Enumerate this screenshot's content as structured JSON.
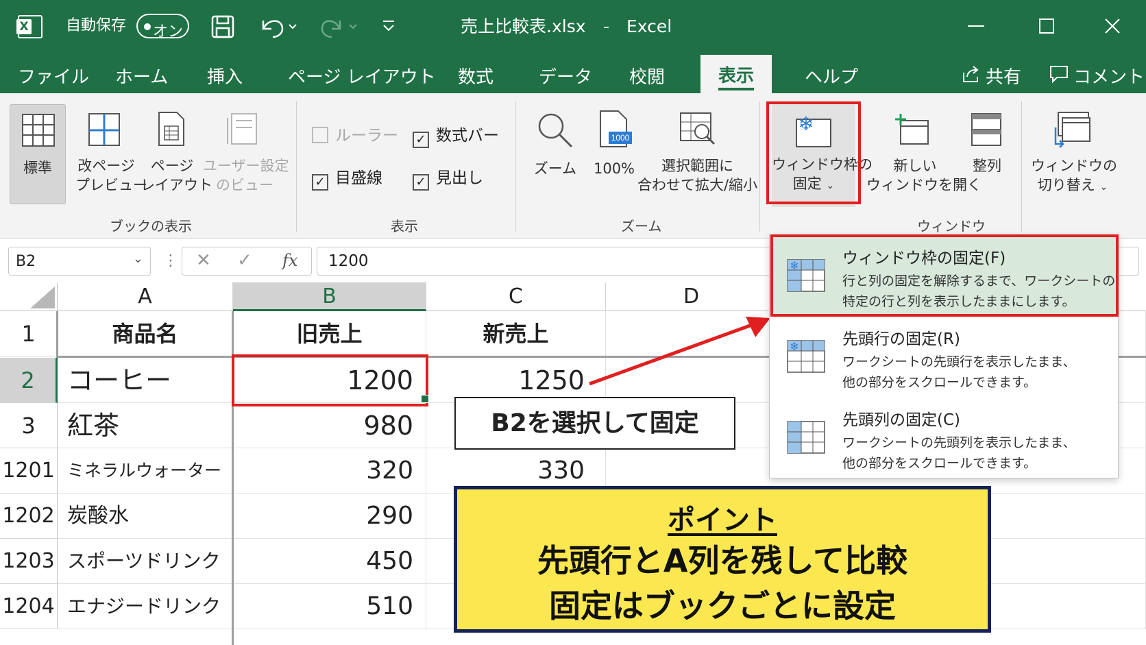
{
  "titlebar": {
    "app_icon": "excel-logo-icon",
    "autosave_label": "自動保存",
    "autosave_state": "オン",
    "filename": "売上比較表.xlsx",
    "separator": "-",
    "app_name": "Excel"
  },
  "menu": {
    "tabs": [
      "ファイル",
      "ホーム",
      "挿入",
      "ページ レイアウト",
      "数式",
      "データ",
      "校閲",
      "表示",
      "ヘルプ"
    ],
    "active_tab": "表示",
    "share": "共有",
    "comment": "コメント"
  },
  "ribbon": {
    "book_view": {
      "label": "ブックの表示",
      "normal": "標準",
      "page_break_1": "改ページ",
      "page_break_2": "プレビュー",
      "page_layout_1": "ページ",
      "page_layout_2": "レイアウト",
      "custom_1": "ユーザー設定",
      "custom_2": "のビュー"
    },
    "show": {
      "label": "表示",
      "ruler": "ルーラー",
      "formula_bar": "数式バー",
      "gridlines": "目盛線",
      "headings": "見出し"
    },
    "zoom": {
      "label": "ズーム",
      "zoom": "ズーム",
      "hundred": "100%",
      "hundred_icon_text": "1000",
      "zoom_sel_1": "選択範囲に",
      "zoom_sel_2": "合わせて拡大/縮小"
    },
    "window": {
      "label": "ウィンドウ",
      "freeze_1": "ウィンドウ枠の",
      "freeze_2": "固定",
      "new_1": "新しい",
      "new_2": "ウィンドウを開く",
      "arrange": "整列",
      "switch_1": "ウィンドウの",
      "switch_2": "切り替え"
    }
  },
  "formula_bar": {
    "name_box": "B2",
    "value": "1200"
  },
  "sheet": {
    "columns": [
      "A",
      "B",
      "C",
      "D"
    ],
    "rows": [
      {
        "num": "1",
        "a": "商品名",
        "b": "旧売上",
        "c": "新売上"
      },
      {
        "num": "2",
        "a": "コーヒー",
        "b": "1200",
        "c": "1250"
      },
      {
        "num": "3",
        "a": "紅茶",
        "b": "980",
        "c": ""
      },
      {
        "num": "1201",
        "a": "ミネラルウォーター",
        "b": "320",
        "c": "330"
      },
      {
        "num": "1202",
        "a": "炭酸水",
        "b": "290",
        "c": ""
      },
      {
        "num": "1203",
        "a": "スポーツドリンク",
        "b": "450",
        "c": ""
      },
      {
        "num": "1204",
        "a": "エナジードリンク",
        "b": "510",
        "c": ""
      }
    ]
  },
  "dropdown": {
    "items": [
      {
        "title": "ウィンドウ枠の固定(F)",
        "desc1": "行と列の固定を解除するまで、ワークシートの",
        "desc2": "特定の行と列を表示したままにします。"
      },
      {
        "title": "先頭行の固定(R)",
        "desc1": "ワークシートの先頭行を表示したまま、",
        "desc2": "他の部分をスクロールできます。"
      },
      {
        "title": "先頭列の固定(C)",
        "desc1": "ワークシートの先頭列を表示したまま、",
        "desc2": "他の部分をスクロールできます。"
      }
    ]
  },
  "annotation": {
    "callout": "B2を選択して固定",
    "point_title": "ポイント",
    "point_line1": "先頭行とA列を残して比較",
    "point_line2": "固定はブックごとに設定"
  },
  "colors": {
    "excel_green": "#1f7145",
    "highlight_red": "#e02020",
    "note_yellow": "#fbe74f",
    "note_border": "#14225a"
  }
}
